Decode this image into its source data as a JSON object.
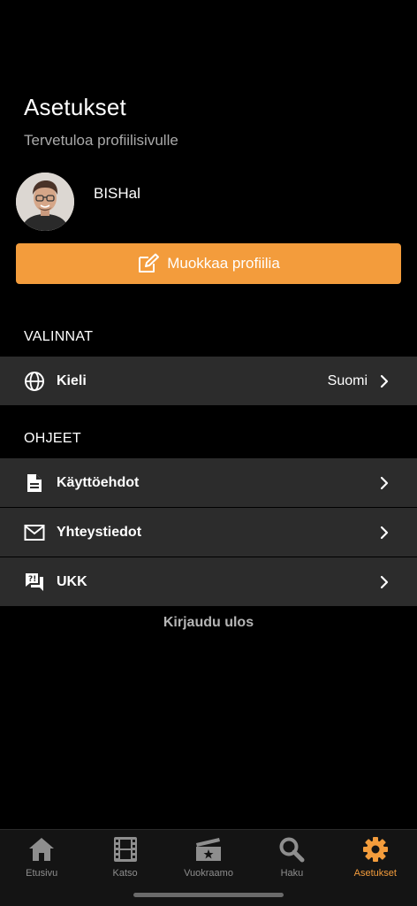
{
  "header": {
    "title": "Asetukset",
    "subtitle": "Tervetuloa profiilisivulle"
  },
  "profile": {
    "username": "BISHal",
    "edit_button_label": "Muokkaa profiilia"
  },
  "sections": {
    "choices": {
      "label": "VALINNAT",
      "language": {
        "label": "Kieli",
        "value": "Suomi",
        "icon": "globe-icon"
      }
    },
    "help": {
      "label": "OHJEET",
      "items": [
        {
          "label": "Käyttöehdot",
          "icon": "document-icon"
        },
        {
          "label": "Yhteystiedot",
          "icon": "mail-icon"
        },
        {
          "label": "UKK",
          "icon": "faq-icon"
        }
      ]
    }
  },
  "logout_label": "Kirjaudu ulos",
  "tabbar": {
    "tabs": [
      {
        "label": "Etusivu",
        "icon": "home-icon",
        "active": false
      },
      {
        "label": "Katso",
        "icon": "film-icon",
        "active": false
      },
      {
        "label": "Vuokraamo",
        "icon": "clapperboard-icon",
        "active": false
      },
      {
        "label": "Haku",
        "icon": "search-icon",
        "active": false
      },
      {
        "label": "Asetukset",
        "icon": "gear-icon",
        "active": true
      }
    ]
  },
  "colors": {
    "accent": "#f39c3c",
    "background": "#000000",
    "row_background": "#2c2c2c",
    "tabbar_background": "#141414",
    "inactive": "#8e8e8e"
  }
}
